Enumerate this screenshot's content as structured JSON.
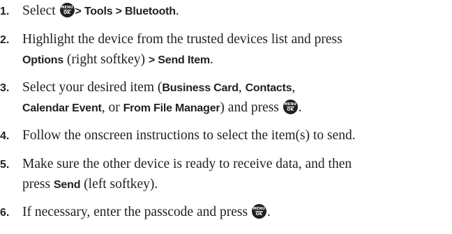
{
  "steps": [
    {
      "num": "1.",
      "t1": "Select ",
      "b1": "> Tools > Bluetooth",
      "t2": "."
    },
    {
      "num": "2.",
      "t1": "Highlight the device from the trusted devices list and press",
      "b1": "Options",
      "t2": " (right softkey) ",
      "b2": "> Send Item",
      "t3": "."
    },
    {
      "num": "3.",
      "t1": "Select your desired item (",
      "b1": "Business Card",
      "t2": ", ",
      "b2": "Contacts",
      "t3": ",",
      "b3": "Calendar Event",
      "t4": ", or ",
      "b4": "From File Manager",
      "t5": ") and press ",
      "t6": "."
    },
    {
      "num": "4.",
      "t1": "Follow the onscreen instructions to select the item(s) to send."
    },
    {
      "num": "5.",
      "t1": "Make sure the other device is ready to receive data, and then",
      "t2": "press ",
      "b1": "Send",
      "t3": " (left softkey)."
    },
    {
      "num": "6.",
      "t1": "If necessary, enter the passcode and press ",
      "t2": "."
    }
  ],
  "menu_key": {
    "icon": "menu-ok-key-icon",
    "top_text": "MENU",
    "bottom_text": "OK",
    "color": "#231f20"
  },
  "text_color": "#231f20"
}
